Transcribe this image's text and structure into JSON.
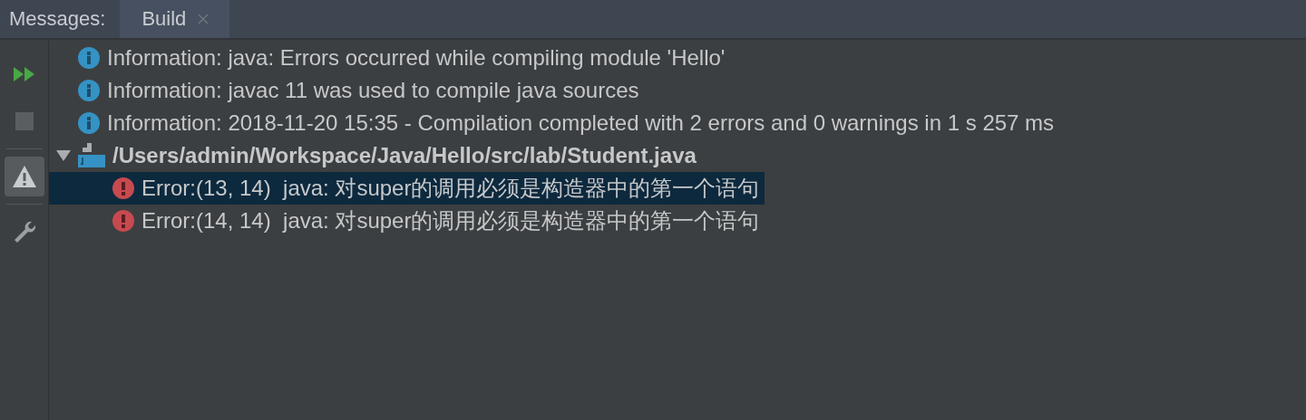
{
  "header": {
    "label": "Messages:",
    "tabs": [
      {
        "label": "Build",
        "selected": true,
        "closable": true
      }
    ]
  },
  "toolbar": [
    {
      "kind": "rerun",
      "selected": false
    },
    {
      "kind": "stop",
      "selected": false
    },
    {
      "kind": "warnings",
      "selected": true
    },
    {
      "kind": "settings",
      "selected": false
    }
  ],
  "messages": [
    {
      "kind": "info",
      "text": "Information: java: Errors occurred while compiling module 'Hello'",
      "selected": false
    },
    {
      "kind": "info",
      "text": "Information: javac 11 was used to compile java sources",
      "selected": false
    },
    {
      "kind": "info",
      "text": "Information: 2018-11-20 15:35 - Compilation completed with 2 errors and 0 warnings in 1 s 257 ms",
      "selected": false
    },
    {
      "kind": "file",
      "text": "/Users/admin/Workspace/Java/Hello/src/lab/Student.java",
      "selected": false,
      "expanded": true,
      "children": [
        {
          "kind": "error",
          "text": "Error:(13, 14)  java: 对super的调用必须是构造器中的第一个语句",
          "selected": true
        },
        {
          "kind": "error",
          "text": "Error:(14, 14)  java: 对super的调用必须是构造器中的第一个语句",
          "selected": false
        }
      ]
    }
  ]
}
